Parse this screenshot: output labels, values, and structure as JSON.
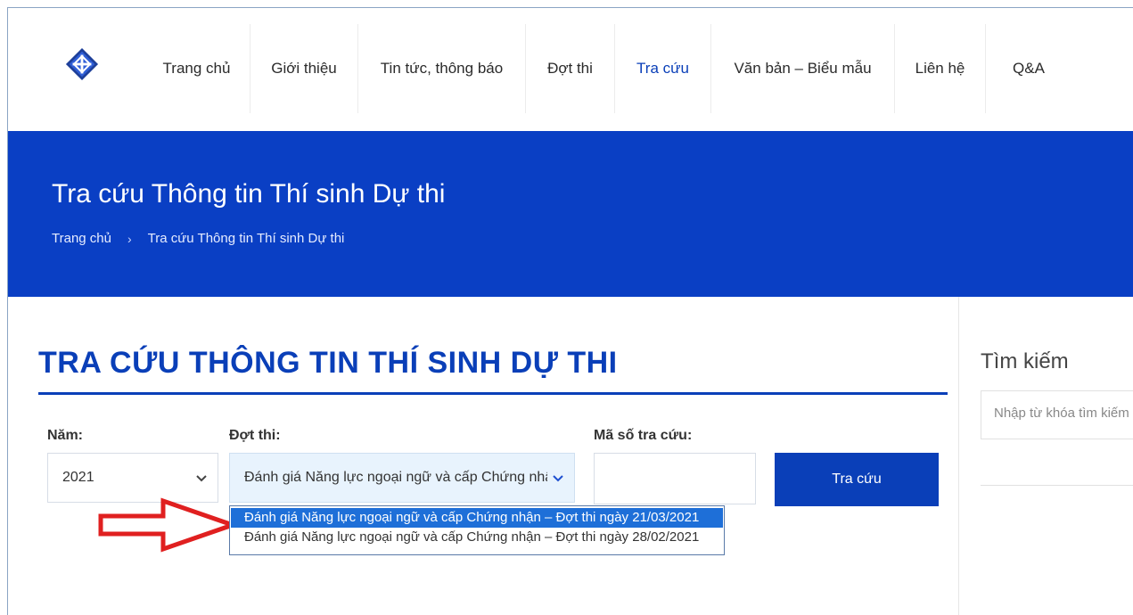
{
  "nav": {
    "items": [
      {
        "label": "Trang chủ"
      },
      {
        "label": "Giới thiệu"
      },
      {
        "label": "Tin tức, thông báo"
      },
      {
        "label": "Đợt thi"
      },
      {
        "label": "Tra cứu"
      },
      {
        "label": "Văn bản – Biểu mẫu"
      },
      {
        "label": "Liên hệ"
      },
      {
        "label": "Q&A"
      }
    ],
    "active": "Tra cứu"
  },
  "banner": {
    "title": "Tra cứu Thông tin Thí sinh Dự thi",
    "breadcrumb_home": "Trang chủ",
    "breadcrumb_separator": "›",
    "breadcrumb_current": "Tra cứu Thông tin Thí sinh Dự thi"
  },
  "main": {
    "heading": "TRA CỨU THÔNG TIN THÍ SINH DỰ THI",
    "year_label": "Năm:",
    "year_value": "2021",
    "exam_label": "Đợt thi:",
    "exam_value": "Đánh giá Năng lực ngoại ngữ và cấp Chứng nhậ",
    "code_label": "Mã số tra cứu:",
    "code_value": "",
    "search_button": "Tra cứu",
    "dropdown_options": [
      {
        "label": "Đánh giá Năng lực ngoại ngữ và cấp Chứng nhận – Đợt thi ngày 21/03/2021",
        "selected": true
      },
      {
        "label": "Đánh giá Năng lực ngoại ngữ và cấp Chứng nhận – Đợt thi ngày 28/02/2021",
        "selected": false
      }
    ]
  },
  "sidebar": {
    "title": "Tìm kiếm",
    "search_placeholder": "Nhập từ khóa tìm kiếm"
  },
  "colors": {
    "brand_blue": "#0a3fc4",
    "accent_blue": "#0a3fb8",
    "selected_option": "#1e6fd8",
    "arrow_red": "#e02020"
  },
  "icons": [
    "logo-diamond-icon",
    "chevron-down-icon",
    "red-arrow-annotation"
  ]
}
